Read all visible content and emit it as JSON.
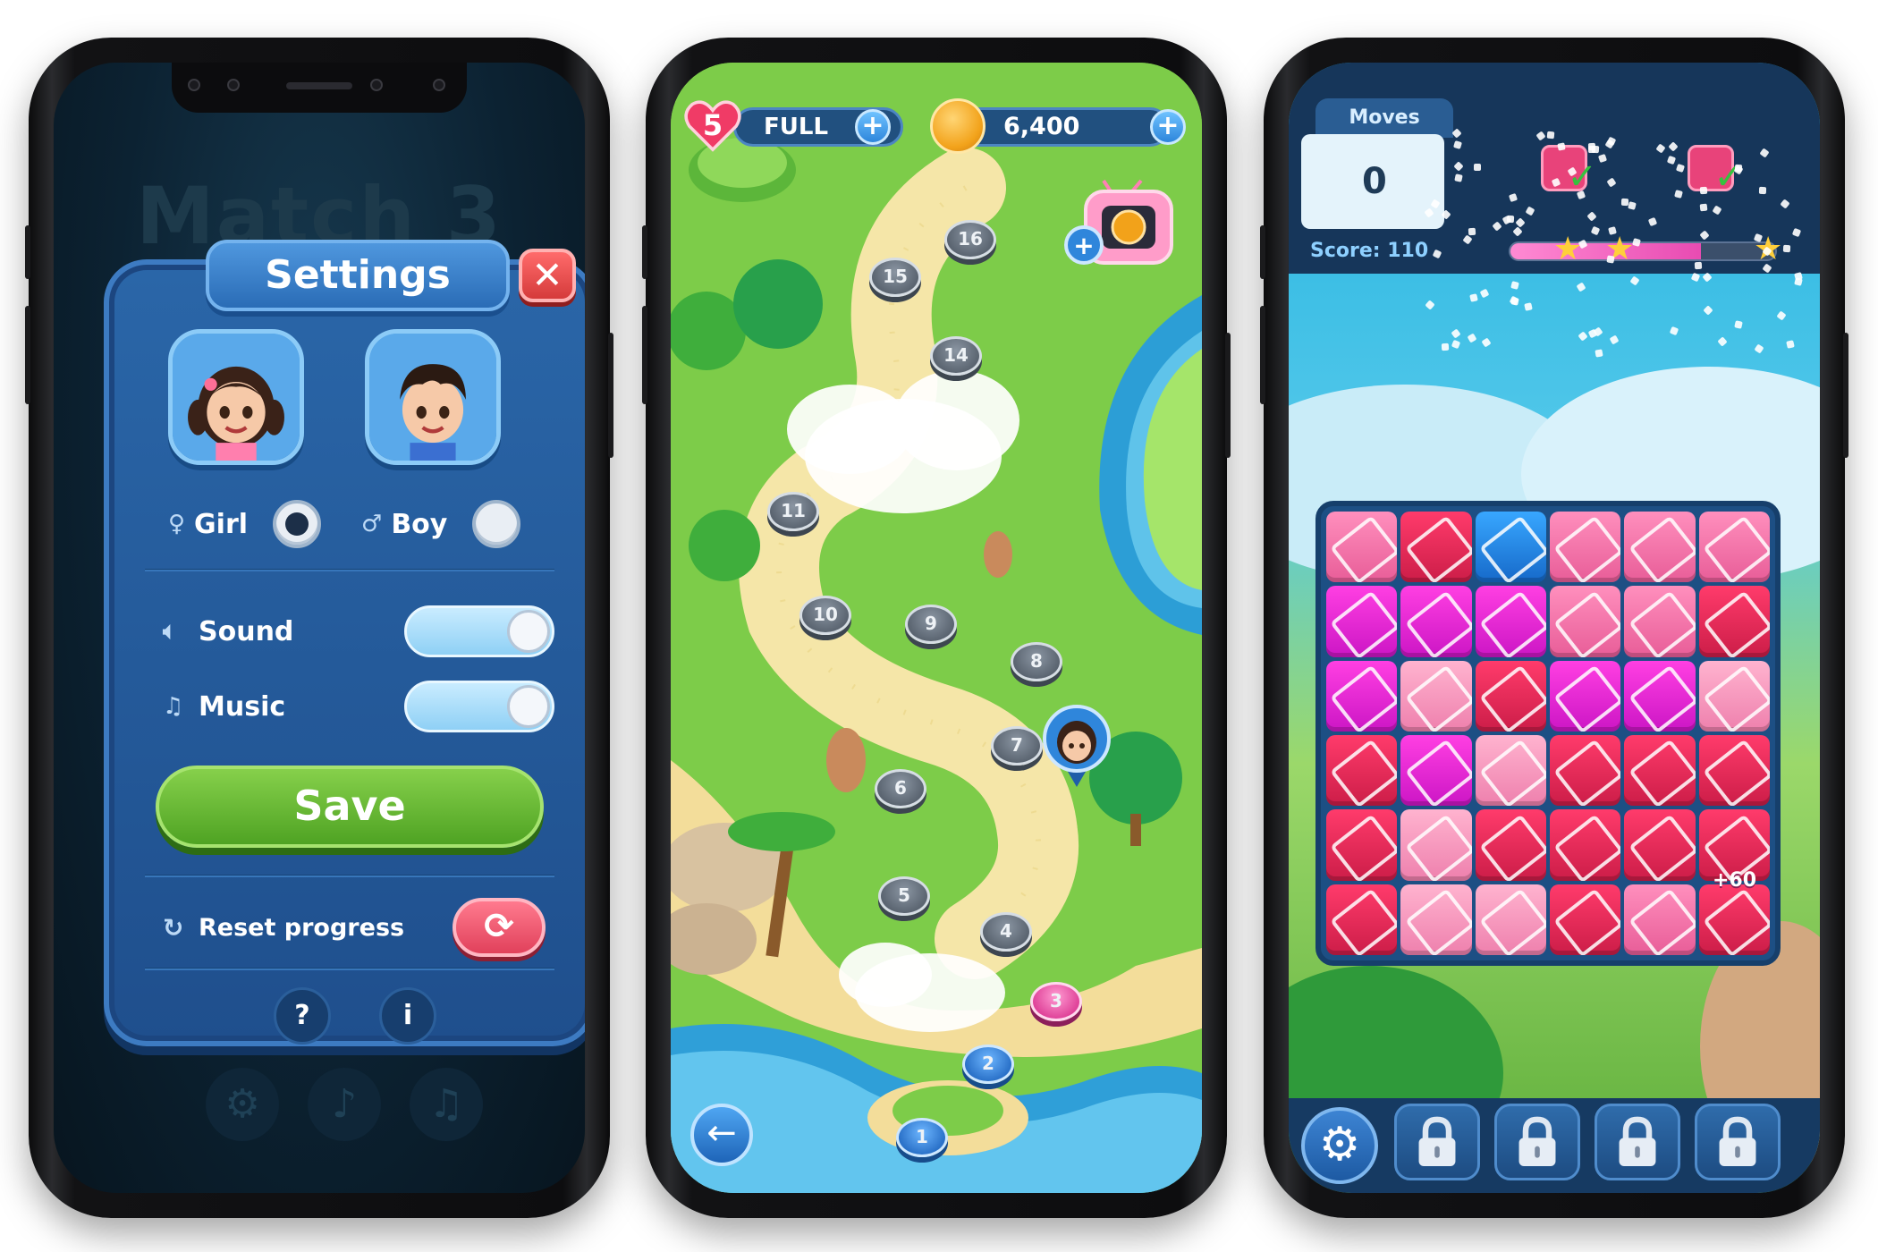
{
  "settings_screen": {
    "background_title": "Match 3",
    "dialog_title": "Settings",
    "close_icon": "close-icon",
    "characters": [
      {
        "label": "Girl",
        "selected": true
      },
      {
        "label": "Boy",
        "selected": false
      }
    ],
    "sound": {
      "label": "Sound",
      "on": true
    },
    "music": {
      "label": "Music",
      "on": true
    },
    "save_label": "Save",
    "reset_label": "Reset progress",
    "help_label": "?",
    "info_label": "i"
  },
  "map_screen": {
    "lives": "5",
    "lives_status": "FULL",
    "coins": "6,400",
    "levels": [
      "16",
      "15",
      "14",
      "11",
      "10",
      "9",
      "8",
      "7",
      "6",
      "5",
      "4",
      "3",
      "2",
      "1"
    ],
    "current_level": "3",
    "colors": {
      "accent": "#2b72c9",
      "current": "#e0449a"
    }
  },
  "game_screen": {
    "moves_label": "Moves",
    "moves_value": "0",
    "score_label": "Score:",
    "score_value": "110",
    "score_progress": 0.72,
    "bonus_text": "+60",
    "board": [
      [
        "pk",
        "rd",
        "bl",
        "pk",
        "pk",
        "pk"
      ],
      [
        "mg",
        "mg",
        "mg",
        "pk",
        "pk",
        "rd"
      ],
      [
        "mg",
        "pkl",
        "rd",
        "mg",
        "mg",
        "pkl"
      ],
      [
        "rd",
        "mg",
        "pkl",
        "rd",
        "rd",
        "rd"
      ],
      [
        "rd",
        "pkl",
        "rd",
        "rd",
        "rd",
        "rd"
      ],
      [
        "rd",
        "pkl",
        "pkl",
        "rd",
        "pk",
        "rd"
      ]
    ],
    "locked_slots": 4
  }
}
